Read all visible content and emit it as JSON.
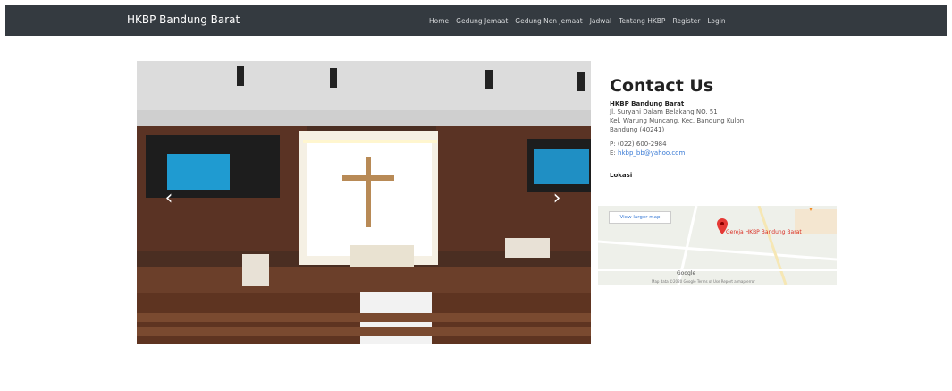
{
  "navbar": {
    "brand": "HKBP Bandung Barat",
    "items": [
      "Home",
      "Gedung Jemaat",
      "Gedung Non Jemaat",
      "Jadwal",
      "Tentang HKBP",
      "Register",
      "Login"
    ]
  },
  "carousel": {
    "prev": "‹",
    "next": "›"
  },
  "contact": {
    "title": "Contact Us",
    "org": "HKBP Bandung Barat",
    "address_lines": [
      "Jl. Suryani Dalam Belakang NO. 51",
      "Kel. Warung Muncang, Kec. Bandung Kulon",
      "Bandung (40241)"
    ],
    "phone_prefix": "P:",
    "phone": "(022) 600-2984",
    "email_prefix": "E:",
    "email": "hkbp_bb@yahoo.com",
    "location_label": "Lokasi"
  },
  "map": {
    "view_larger": "View larger map",
    "place_name": "Gereja HKBP Bandung Barat",
    "google": "Google",
    "footer": "Map data ©2020 Google   Terms of Use   Report a map error"
  },
  "colors": {
    "navbar": "#343a40",
    "pin": "#e53935",
    "link": "#3a7bd5"
  }
}
